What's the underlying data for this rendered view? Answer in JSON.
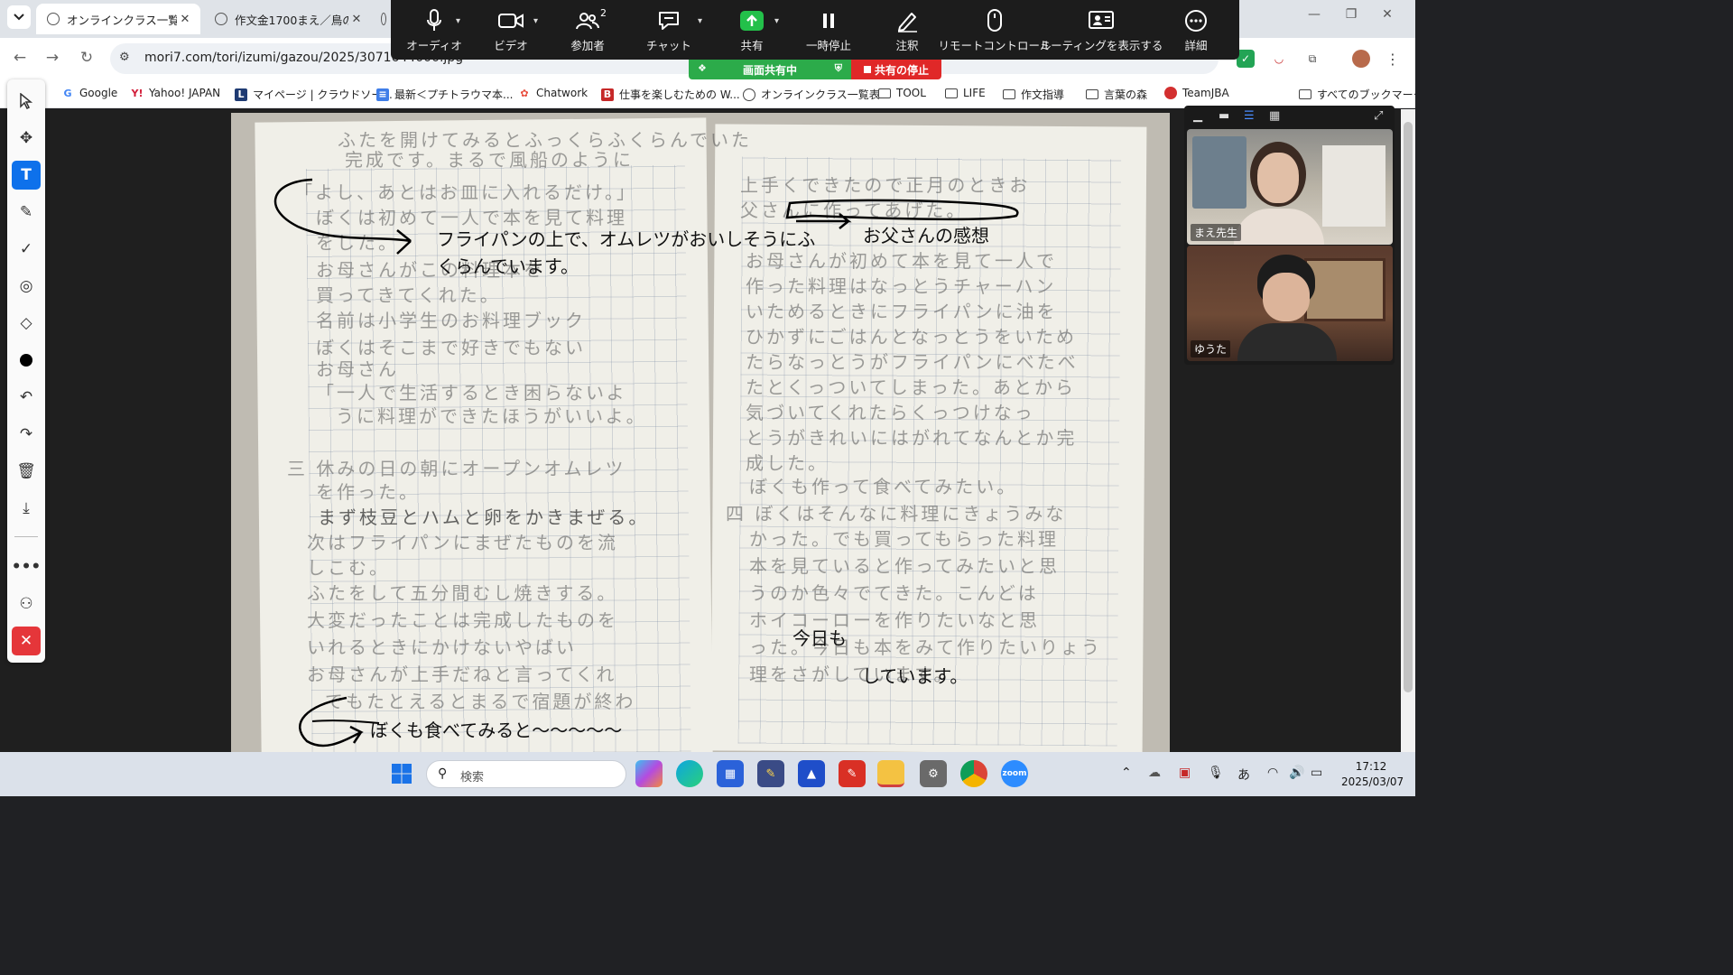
{
  "browser": {
    "tabs": [
      {
        "title": "オンラインクラス一覧表",
        "active": true
      },
      {
        "title": "作文金1700まえ／鳥の",
        "active": false
      }
    ],
    "url": "mori7.com/tori/izumi/gazou/2025/3071644000.jpg"
  },
  "bookmarks": [
    {
      "label": "Google",
      "icon": "google-icon"
    },
    {
      "label": "Yahoo! JAPAN",
      "icon": "yahoo-icon"
    },
    {
      "label": "マイページ | クラウドソー...",
      "icon": "lancers-icon"
    },
    {
      "label": "最新＜プチトラウマ本...",
      "icon": "docs-icon"
    },
    {
      "label": "Chatwork",
      "icon": "chatwork-icon"
    },
    {
      "label": "仕事を楽しむための W...",
      "icon": "b-icon"
    },
    {
      "label": "オンラインクラス一覧表",
      "icon": "globe-icon"
    },
    {
      "label": "TOOL",
      "icon": "folder-icon"
    },
    {
      "label": "LIFE",
      "icon": "folder-icon"
    },
    {
      "label": "作文指導",
      "icon": "folder-icon"
    },
    {
      "label": "言葉の森",
      "icon": "folder-icon"
    },
    {
      "label": "TeamJBA",
      "icon": "teamjba-icon"
    },
    {
      "label": "すべてのブックマーク",
      "icon": "folder-icon"
    }
  ],
  "zoom_toolbar": {
    "buttons": [
      {
        "label": "オーディオ",
        "icon": "microphone-icon"
      },
      {
        "label": "ビデオ",
        "icon": "video-camera-icon"
      },
      {
        "label": "参加者",
        "icon": "participants-icon",
        "badge": "2"
      },
      {
        "label": "チャット",
        "icon": "chat-icon"
      },
      {
        "label": "共有",
        "icon": "share-screen-icon"
      },
      {
        "label": "一時停止",
        "icon": "pause-icon"
      },
      {
        "label": "注釈",
        "icon": "annotate-pen-icon"
      },
      {
        "label": "リモートコントロール",
        "icon": "mouse-icon"
      },
      {
        "label": "ミーティングを表示する",
        "icon": "show-meeting-icon"
      },
      {
        "label": "詳細",
        "icon": "more-icon"
      }
    ],
    "sharing_label": "画面共有中",
    "stop_label": "共有の停止"
  },
  "annotation_tools": [
    "select",
    "move",
    "text",
    "pen",
    "stamp",
    "spotlight",
    "eraser",
    "color",
    "undo",
    "redo",
    "clear",
    "save",
    "more",
    "request",
    "close"
  ],
  "annotations": [
    {
      "text": "フライパンの上で、オムレツがおいしそうにふ"
    },
    {
      "text": "くらんでいます。"
    },
    {
      "text": "お父さんの感想"
    },
    {
      "text": "今日も"
    },
    {
      "text": "しています。"
    },
    {
      "text": "ぼくも食べてみると〜〜〜〜〜"
    }
  ],
  "handwriting": {
    "left_page": [
      "ふたを開けてみるとふっくらふくらんでいた",
      "完成です。まるで風船のように",
      "「よし、あとはお皿に入れるだけ。」",
      "ぼくは初めて一人で本を見て料理",
      "をした。",
      "お母さんがこの料理本を",
      "買ってきてくれた。",
      "名前は小学生のお料理ブック",
      "ぼくはそこまで好きでもない",
      "お母さん",
      "「一人で生活するとき困らないよ",
      "うに料理ができたほうがいいよ。",
      "三 休みの日の朝にオープンオムレツ",
      "を作った。",
      "まず枝豆とハムと卵をかきまぜる。",
      "次はフライパンにまぜたものを流",
      "しこむ。",
      "ふたをして五分間むし焼きする。",
      "大変だったことは完成したものを",
      "いれるときにかけないやばい",
      "お母さんが上手だねと言ってくれ",
      "でもたとえるとまるで宿題が終わ"
    ],
    "right_page": [
      "上手くできたので正月のときお",
      "父さんに作ってあげた。",
      "お母さんが初めて本を見て一人で",
      "作った料理はなっとうチャーハン",
      "いためるときにフライパンに油を",
      "ひかずにごはんとなっとうをいため",
      "たらなっとうがフライパンにべたべ",
      "たとくっついてしまった。あとから",
      "気づいてくれたらくっつけなっ",
      "とうがきれいにはがれてなんとか完",
      "成した。",
      "ぼくも作って食べてみたい。",
      "四 ぼくはそんなに料理にきょうみな",
      "かった。でも買ってもらった料理",
      "本を見ていると作ってみたいと思",
      "うのか色々でてきた。こんどは",
      "ホイコーローを作りたいなと思",
      "った。今日も本をみて作りたいりょう",
      "理をさがしています。"
    ]
  },
  "video_panel": {
    "participants": [
      {
        "name": "まえ先生"
      },
      {
        "name": "ゆうた"
      }
    ]
  },
  "taskbar": {
    "search_placeholder": "検索",
    "apps": [
      "windows-start-icon",
      "copilot-icon",
      "edge-icon",
      "store-icon",
      "explorer-app-icon",
      "photos-icon",
      "acrobat-icon",
      "file-explorer-icon",
      "settings-icon",
      "chrome-icon",
      "zoom-icon"
    ],
    "ime": "あ",
    "time": "17:12",
    "date": "2025/03/07"
  }
}
